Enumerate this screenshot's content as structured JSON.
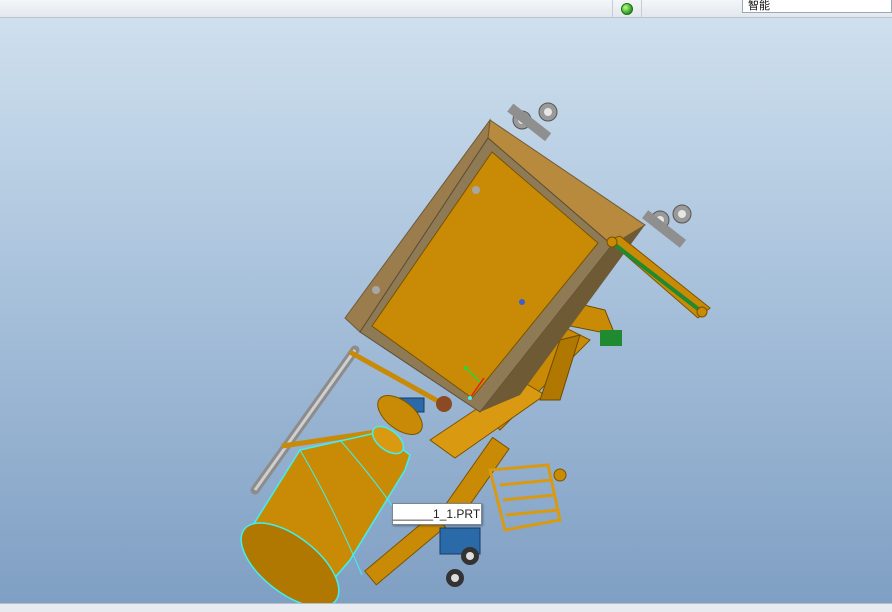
{
  "toolbar": {
    "status_icon": "green-status-led",
    "filter_value": "智能"
  },
  "viewport": {
    "hover_tooltip": "______1_1.PRT"
  },
  "colors": {
    "model_body": "#c98a05",
    "model_frame": "#8f7a56",
    "selection_outline": "#3ff0f0",
    "conveyor_belt": "#1f8a30"
  }
}
